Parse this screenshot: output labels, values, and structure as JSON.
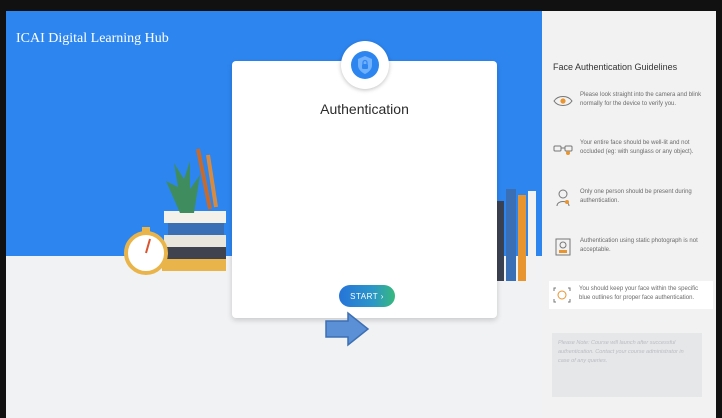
{
  "app": {
    "brand": "ICAI Digital Learning Hub"
  },
  "auth_card": {
    "title": "Authentication",
    "start_label": "START ›"
  },
  "guidelines": {
    "title": "Face Authentication Guidelines",
    "items": [
      {
        "icon": "eye-icon",
        "text": "Please look straight into the camera and blink normally for the device to verify you."
      },
      {
        "icon": "glasses-icon",
        "text": "Your entire face should be well-lit and not occluded (eg: with sunglass or any object)."
      },
      {
        "icon": "person-icon",
        "text": "Only one person should be present during authentication."
      },
      {
        "icon": "photo-icon",
        "text": "Authentication using static photograph is not acceptable."
      },
      {
        "icon": "face-outline-icon",
        "text": "You should keep your face within the specific blue outlines for proper face authentication."
      }
    ],
    "note": "Please Note: Course will launch after successful authentication. Contact your course administrator in case of any queries."
  },
  "colors": {
    "brand_blue": "#2d86f0",
    "start_gradient_start": "#2674d9",
    "start_gradient_end": "#37b97d",
    "arrow": "#5b8fd6"
  }
}
